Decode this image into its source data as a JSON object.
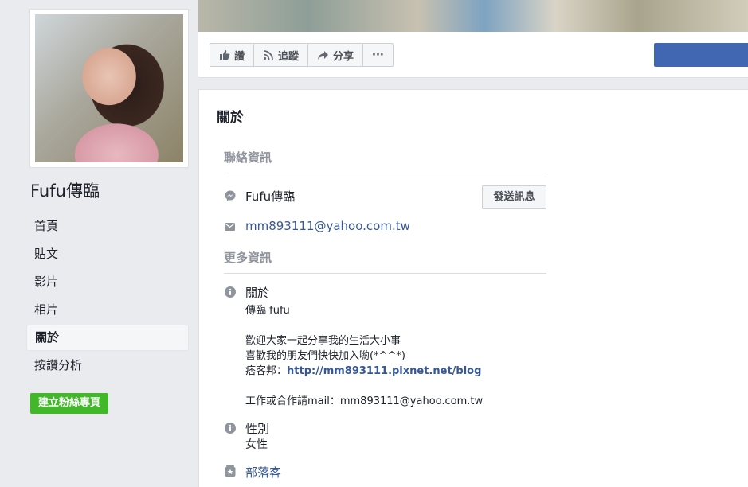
{
  "page": {
    "name": "Fufu傳臨"
  },
  "nav": {
    "items": [
      {
        "label": "首頁"
      },
      {
        "label": "貼文"
      },
      {
        "label": "影片"
      },
      {
        "label": "相片"
      },
      {
        "label": "關於",
        "active": true
      },
      {
        "label": "按讚分析"
      }
    ],
    "create_label": "建立粉絲專頁"
  },
  "actions": {
    "like_label": "讚",
    "follow_label": "追蹤",
    "share_label": "分享",
    "more_label": "···"
  },
  "about": {
    "title": "關於",
    "contact_header": "聯絡資訊",
    "messenger_name": "Fufu傳臨",
    "send_message_label": "發送訊息",
    "email": "mm893111@yahoo.com.tw",
    "more_header": "更多資訊",
    "about_label": "關於",
    "about_lines": {
      "line1": "傳臨 fufu",
      "line2": "歡迎大家一起分享我的生活大小事",
      "line3": "喜歡我的朋友們快快加入喲(*^^*)",
      "line4_prefix": "痞客邦：",
      "line4_link": "http://mm893111.pixnet.net/blog",
      "line5": "工作或合作請mail：mm893111@yahoo.com.tw"
    },
    "gender_label": "性別",
    "gender_value": "女性",
    "blog_label": "部落客"
  },
  "colors": {
    "link": "#365899",
    "create_button": "#42b72a",
    "primary_button": "#4267b2"
  }
}
